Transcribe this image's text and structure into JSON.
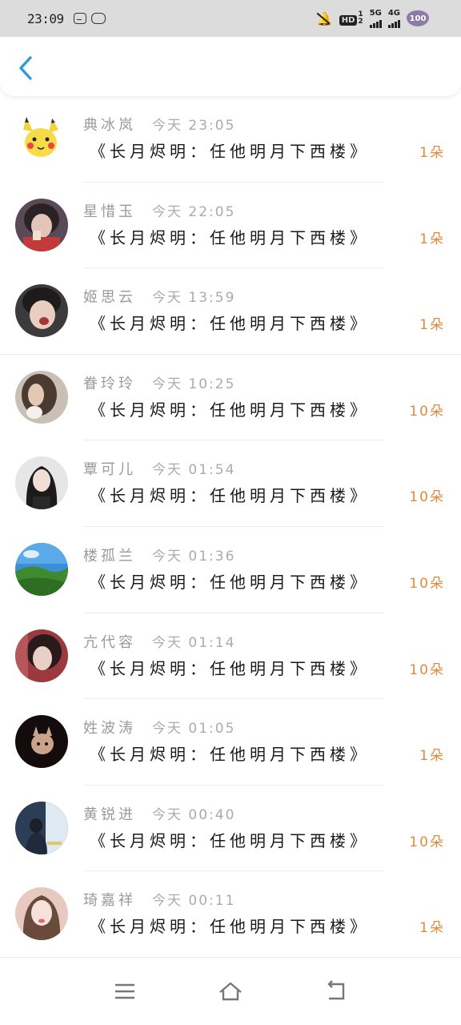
{
  "status_bar": {
    "time": "23:09",
    "network_1": "5G",
    "network_2": "4G",
    "hd_badge": "HD",
    "sim_1": "1",
    "sim_2": "2",
    "battery": "100"
  },
  "icons": {
    "back": "chevron-left-icon",
    "menu": "menu-icon",
    "home": "home-icon",
    "back_nav": "return-icon"
  },
  "colors": {
    "accent": "#2f9bd8",
    "count": "#e08a3e",
    "name": "#9a9a9a",
    "gift": "#1a1a1a"
  },
  "records": [
    {
      "name": "典冰岚",
      "time": "今天 23:05",
      "gift": "《长月烬明：任他明月下西楼》",
      "count": "1朵"
    },
    {
      "name": "星惜玉",
      "time": "今天 22:05",
      "gift": "《长月烬明：任他明月下西楼》",
      "count": "1朵"
    },
    {
      "name": "姬思云",
      "time": "今天 13:59",
      "gift": "《长月烬明：任他明月下西楼》",
      "count": "1朵"
    },
    {
      "name": "眷玲玲",
      "time": "今天 10:25",
      "gift": "《长月烬明：任他明月下西楼》",
      "count": "10朵"
    },
    {
      "name": "覃可儿",
      "time": "今天 01:54",
      "gift": "《长月烬明：任他明月下西楼》",
      "count": "10朵"
    },
    {
      "name": "楼孤兰",
      "time": "今天 01:36",
      "gift": "《长月烬明：任他明月下西楼》",
      "count": "10朵"
    },
    {
      "name": "亢代容",
      "time": "今天 01:14",
      "gift": "《长月烬明：任他明月下西楼》",
      "count": "10朵"
    },
    {
      "name": "姓波涛",
      "time": "今天 01:05",
      "gift": "《长月烬明：任他明月下西楼》",
      "count": "1朵"
    },
    {
      "name": "黄锐进",
      "time": "今天 00:40",
      "gift": "《长月烬明：任他明月下西楼》",
      "count": "10朵"
    },
    {
      "name": "琦嘉祥",
      "time": "今天 00:11",
      "gift": "《长月烬明：任他明月下西楼》",
      "count": "1朵"
    }
  ]
}
